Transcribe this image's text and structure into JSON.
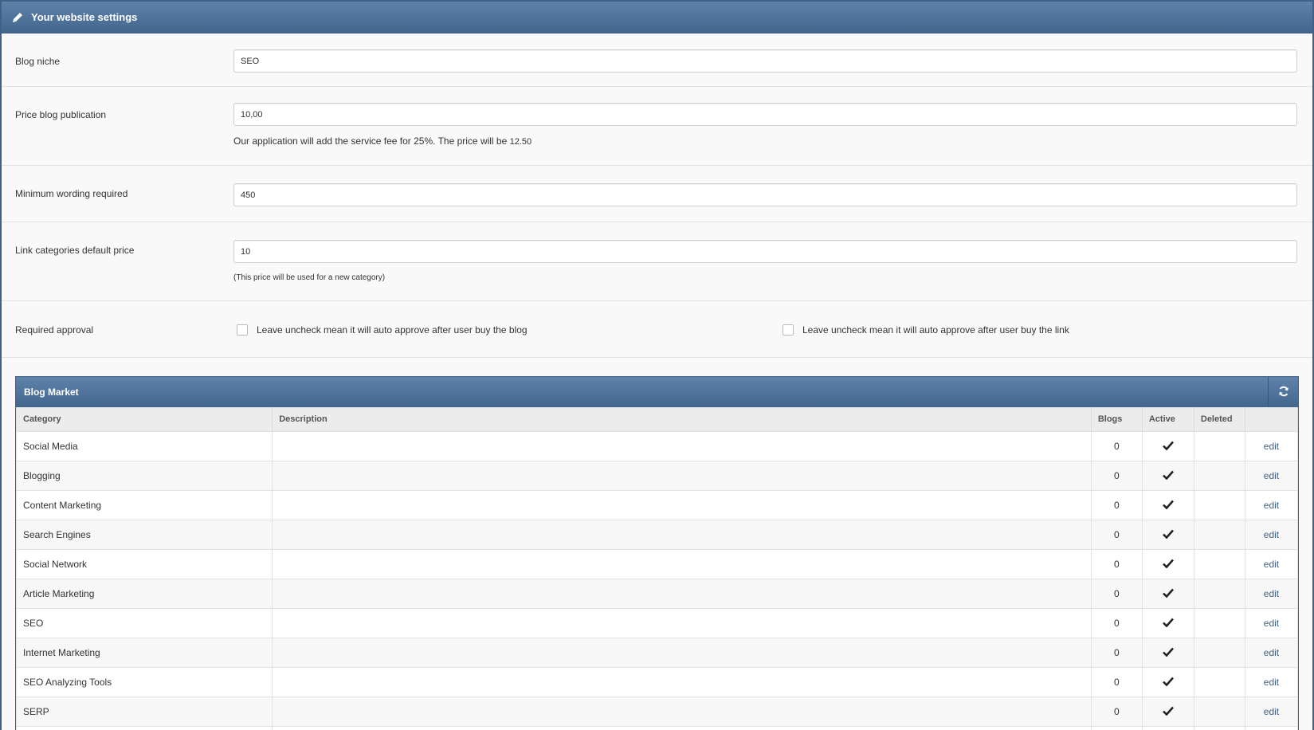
{
  "settings": {
    "title": "Your website settings",
    "blog_niche": {
      "label": "Blog niche",
      "value": "SEO"
    },
    "price": {
      "label": "Price blog publication",
      "value": "10,00",
      "help": "Our application will add the service fee for 25%. The price will be",
      "computed": "12.50"
    },
    "min_words": {
      "label": "Minimum wording required",
      "value": "450"
    },
    "link_price": {
      "label": "Link categories default price",
      "value": "10",
      "help": "(This price will be used for a new category)"
    },
    "approval": {
      "label": "Required approval",
      "blog_option": "Leave uncheck mean it will auto approve after user buy the blog",
      "link_option": "Leave uncheck mean it will auto approve after user buy the link"
    }
  },
  "market": {
    "title": "Blog Market",
    "columns": {
      "category": "Category",
      "description": "Description",
      "blogs": "Blogs",
      "active": "Active",
      "deleted": "Deleted"
    },
    "edit_label": "edit",
    "rows": [
      {
        "category": "Social Media",
        "description": "",
        "blogs": "0",
        "active": true,
        "deleted": false
      },
      {
        "category": "Blogging",
        "description": "",
        "blogs": "0",
        "active": true,
        "deleted": false
      },
      {
        "category": "Content Marketing",
        "description": "",
        "blogs": "0",
        "active": true,
        "deleted": false
      },
      {
        "category": "Search Engines",
        "description": "",
        "blogs": "0",
        "active": true,
        "deleted": false
      },
      {
        "category": "Social Network",
        "description": "",
        "blogs": "0",
        "active": true,
        "deleted": false
      },
      {
        "category": "Article Marketing",
        "description": "",
        "blogs": "0",
        "active": true,
        "deleted": false
      },
      {
        "category": "SEO",
        "description": "",
        "blogs": "0",
        "active": true,
        "deleted": false
      },
      {
        "category": "Internet Marketing",
        "description": "",
        "blogs": "0",
        "active": true,
        "deleted": false
      },
      {
        "category": "SEO Analyzing Tools",
        "description": "",
        "blogs": "0",
        "active": true,
        "deleted": false
      },
      {
        "category": "SERP",
        "description": "",
        "blogs": "0",
        "active": true,
        "deleted": false
      },
      {
        "category": "",
        "description": "",
        "blogs": "",
        "active": false,
        "deleted": false
      }
    ]
  },
  "icons": {
    "header": "pencil-icon",
    "refresh": "refresh-icon",
    "active": "checkmark-icon"
  },
  "colors": {
    "header": "#4a6d94",
    "link": "#3b5f86"
  }
}
